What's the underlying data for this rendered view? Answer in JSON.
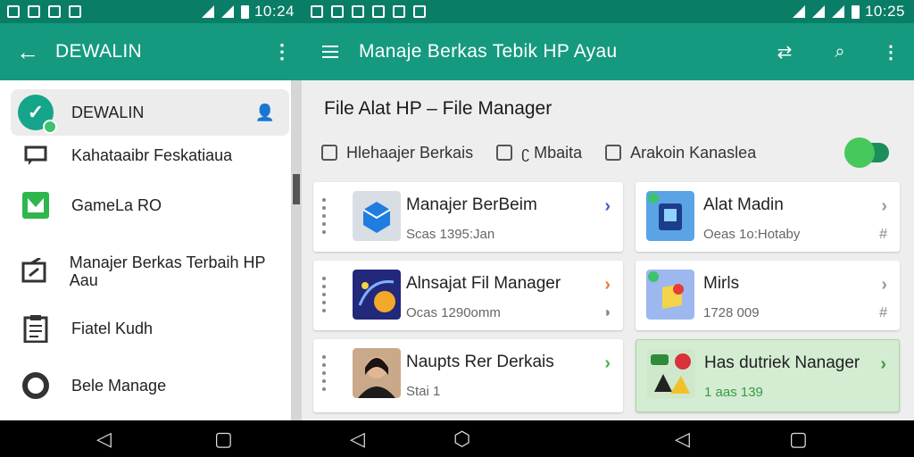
{
  "left_status": {
    "time": "10:24"
  },
  "right_status": {
    "time": "10:25"
  },
  "left_appbar": {
    "title": "DEWALIN"
  },
  "right_appbar": {
    "title": "Manaje Berkas Tebik HP Ayau"
  },
  "drawer": {
    "user_name": "DEWALIN",
    "items": [
      {
        "label": "Kahataaibr Feskatiaua",
        "icon": "chat-icon"
      },
      {
        "label": "GameLa RO",
        "icon": "green-mail-icon"
      },
      {
        "label": "Manajer Berkas Terbaih HP Aau",
        "icon": "tv-icon"
      },
      {
        "label": "Fiatel Kudh",
        "icon": "clipboard-icon"
      },
      {
        "label": "Bele Manage",
        "icon": "ring-icon"
      }
    ]
  },
  "main": {
    "heading": "File Alat HP – File Manager",
    "filters": [
      {
        "label": "Hlehaajer Berkais"
      },
      {
        "label": "ʗ Mbaita"
      },
      {
        "label": "Arakoin Kanaslea"
      }
    ],
    "toggle_on": true,
    "cards": [
      {
        "name": "Manajer BerBeim",
        "sub": "Scas 1395:Jan",
        "chev_color": "#3b5bd8",
        "meta": ""
      },
      {
        "name": "Alat Madin",
        "sub": "Oeas 1o:Hotaby",
        "chev_color": "#999999",
        "meta": "#"
      },
      {
        "name": "Alnsajat Fil Manager",
        "sub": "Ocas 1290omm",
        "chev_color": "#f07a2a",
        "meta": "◑"
      },
      {
        "name": "Mirls",
        "sub": "1728 009",
        "chev_color": "#999999",
        "meta": "#"
      },
      {
        "name": "Naupts Rer Derkais",
        "sub": "Stai 1",
        "chev_color": "#4caf50",
        "meta": ""
      },
      {
        "name": "Has dutriek Nanager",
        "sub": "1 aas 139",
        "chev_color": "#3a9a45",
        "meta": ""
      }
    ]
  },
  "colors": {
    "status_bar": "#0a7d66",
    "app_bar": "#159a80",
    "accent": "#47c85c"
  }
}
